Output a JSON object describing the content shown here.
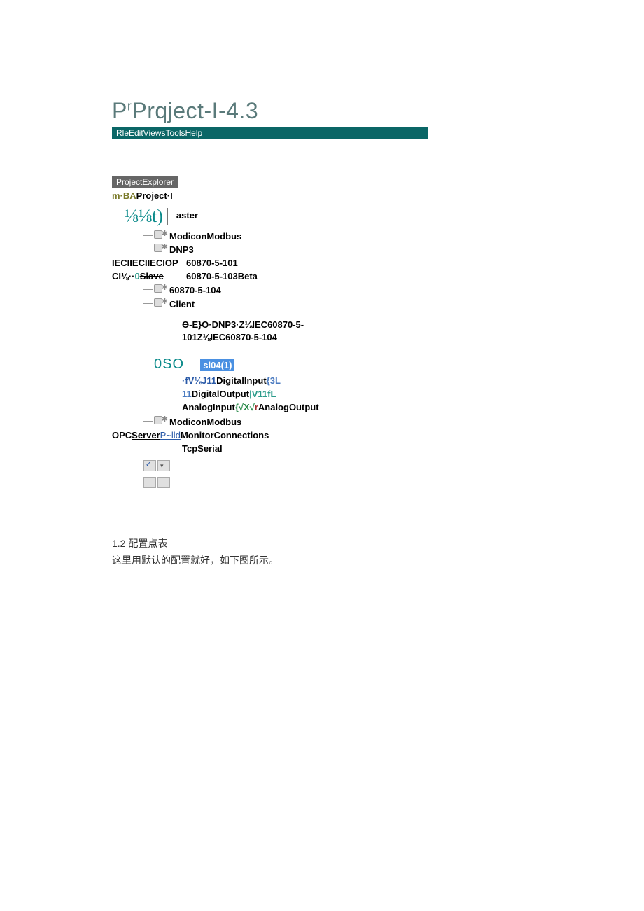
{
  "title": {
    "prefix": "P",
    "sup": "r",
    "rest": "Prqject-I-4.3"
  },
  "menubar": "RleEditViewsToolsHelp",
  "explorer_label": "ProjectExplorer",
  "tree": {
    "root": {
      "pre": "m·",
      "accent": "BA",
      "rest": "Project·I"
    },
    "frac": "⅛⅛t)",
    "master": "aster",
    "items_top": [
      "ModiconModbus",
      "DNP3"
    ],
    "iec_left": "IECIIECIIECIOP",
    "iec_p1": "60870-5-101",
    "ci_left_a": "CI⅛··",
    "ci_left_b": "0",
    "ci_left_c": "Slave",
    "iec_p2": "60870-5-103Beta",
    "iec_p3": "60870-5-104",
    "client": "Client",
    "theta_line": "Ɵ-E}O·DNP3·Z⅛IEC60870-5-101Z⅛IEC60870-5-104",
    "oso": "0SO",
    "sl04": "sl04(1)",
    "di_pre": "·fV⅛J11",
    "di": "DigitalInput",
    "di_suf": "{3",
    "do_pre": "11",
    "do": "DigitalOutput",
    "do_suf": "|V11fL",
    "ai": "AnalogInput",
    "ai_suf": "{√X√",
    "ao": "AnalogOutput",
    "modicon2": "ModiconModbus",
    "opc_a": "OPC",
    "opc_b": "Server",
    "opc_link": "P~lld",
    "opc_c": "MonitorConnections",
    "tcp": "TcpSerial"
  },
  "section": {
    "heading": "1.2 配置点表",
    "body": "这里用默认的配置就好，如下图所示。"
  }
}
